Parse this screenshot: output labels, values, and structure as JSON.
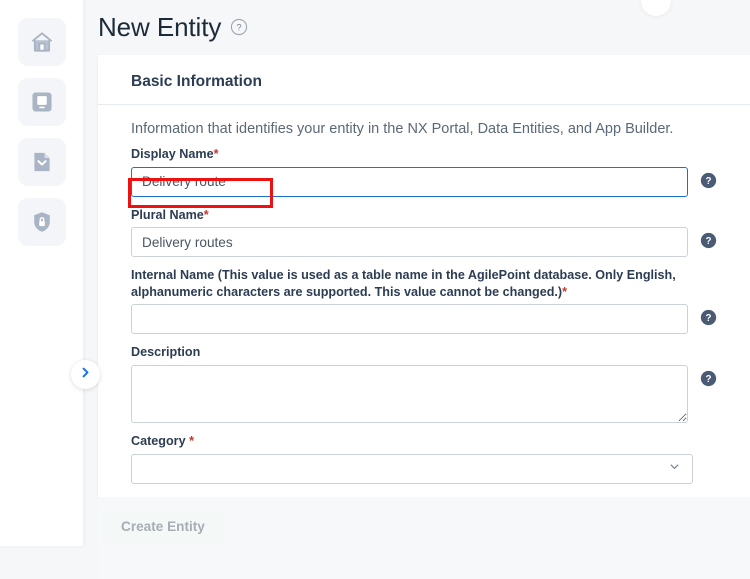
{
  "sidebar": {
    "items": [
      {
        "name": "home",
        "icon": "home-icon",
        "label": "Home"
      },
      {
        "name": "app-builder",
        "icon": "monitor-icon",
        "label": "App Builder"
      },
      {
        "name": "data-entities",
        "icon": "document-chevron-icon",
        "label": "Data Entities"
      },
      {
        "name": "access-control",
        "icon": "shield-lock-icon",
        "label": "Access Control"
      }
    ],
    "expand_handle_icon": "chevron-right-icon"
  },
  "header": {
    "title": "New Entity",
    "help_icon": "question-mark-icon"
  },
  "card": {
    "section_title": "Basic Information",
    "intro": "Information that identifies your entity in the NX Portal, Data Entities, and App Builder."
  },
  "form": {
    "display_name": {
      "label": "Display Name",
      "required": true,
      "required_mark": "*",
      "value": "Delivery route",
      "placeholder": "",
      "focused": true,
      "help_icon": "question-mark-icon"
    },
    "plural_name": {
      "label": "Plural Name",
      "required": true,
      "required_mark": "*",
      "value": "Delivery routes",
      "placeholder": "",
      "focused": false,
      "help_icon": "question-mark-icon"
    },
    "internal_name": {
      "label": "Internal Name (This value is used as a table name in the AgilePoint database. Only English, alphanumeric characters are supported. This value cannot be changed.)",
      "required": true,
      "required_mark": "*",
      "value": "",
      "placeholder": "",
      "focused": false,
      "help_icon": "question-mark-icon"
    },
    "description": {
      "label": "Description",
      "required": false,
      "required_mark": "",
      "value": "",
      "placeholder": "",
      "focused": false,
      "help_icon": "question-mark-icon"
    },
    "category": {
      "label": "Category",
      "required": true,
      "required_mark": "*",
      "value": "",
      "placeholder": "",
      "chevron_icon": "chevron-down-icon"
    }
  },
  "footer": {
    "create_label": "Create Entity",
    "create_disabled": true
  },
  "annotation": {
    "type": "highlight-rectangle",
    "color": "#ee1111",
    "targets": "display-name-input"
  },
  "colors": {
    "page_background": "#f6f7f9",
    "card_background": "#ffffff",
    "accent_focus": "#1a73c9",
    "required_star": "#c0392b",
    "title_text": "#1c2b3a",
    "label_text": "#2c3d53",
    "muted_text": "#5b6876",
    "rail_icon": "#a9b4c4",
    "annotation_red": "#ee1111"
  }
}
